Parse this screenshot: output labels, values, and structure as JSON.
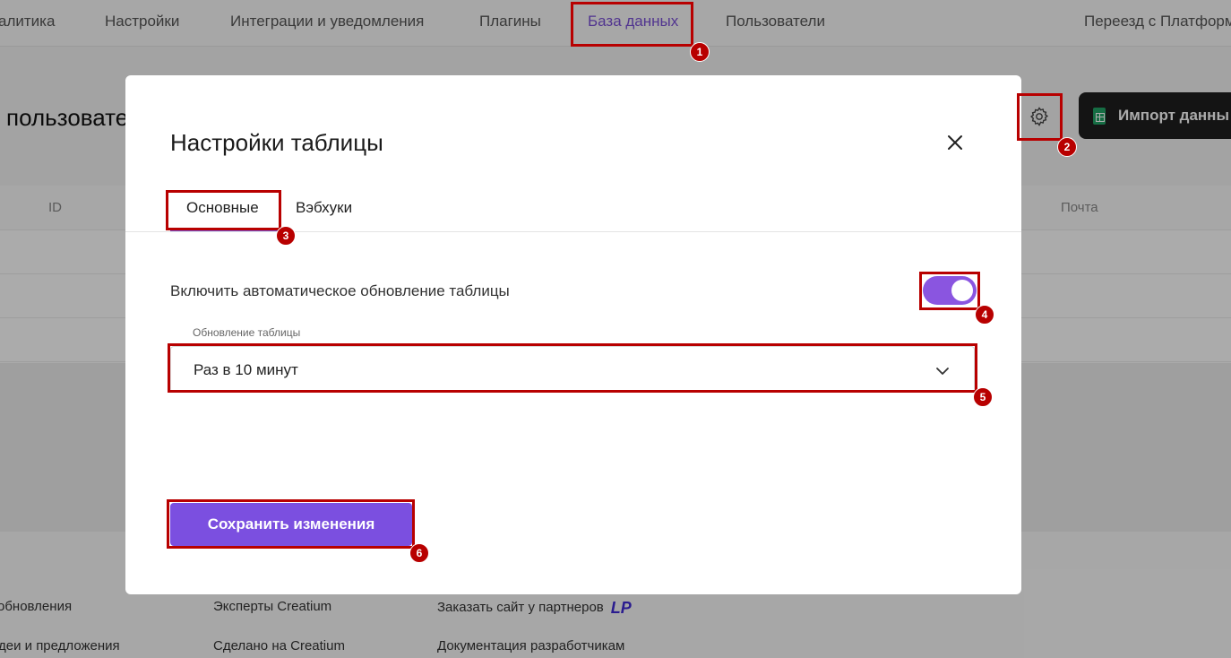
{
  "topnav": {
    "items": [
      "алитика",
      "Настройки",
      "Интеграции и уведомления",
      "Плагины",
      "База данных",
      "Пользователи",
      "Переезд с Платформ"
    ],
    "active_index": 4
  },
  "page": {
    "title": "пользовате",
    "import_button": "Импорт данны"
  },
  "table": {
    "columns": [
      "ID",
      "Почта"
    ]
  },
  "footer": {
    "links": [
      "обновления",
      "деи и предложения",
      "Эксперты Creatium",
      "Сделано на Creatium",
      "Заказать сайт у партнеров",
      "Документация разработчикам"
    ],
    "partner_logo": "LP"
  },
  "modal": {
    "title": "Настройки таблицы",
    "tabs": [
      "Основные",
      "Вэбхуки"
    ],
    "active_tab": 0,
    "toggle_label": "Включить автоматическое обновление таблицы",
    "toggle_on": true,
    "select_label": "Обновление таблицы",
    "select_value": "Раз в 10 минут",
    "save_button": "Сохранить изменения"
  },
  "annotations": [
    "1",
    "2",
    "3",
    "4",
    "5",
    "6"
  ],
  "colors": {
    "accent": "#7b4fe0",
    "annotation": "#b80000",
    "import_button_bg": "#1f1f1f"
  }
}
